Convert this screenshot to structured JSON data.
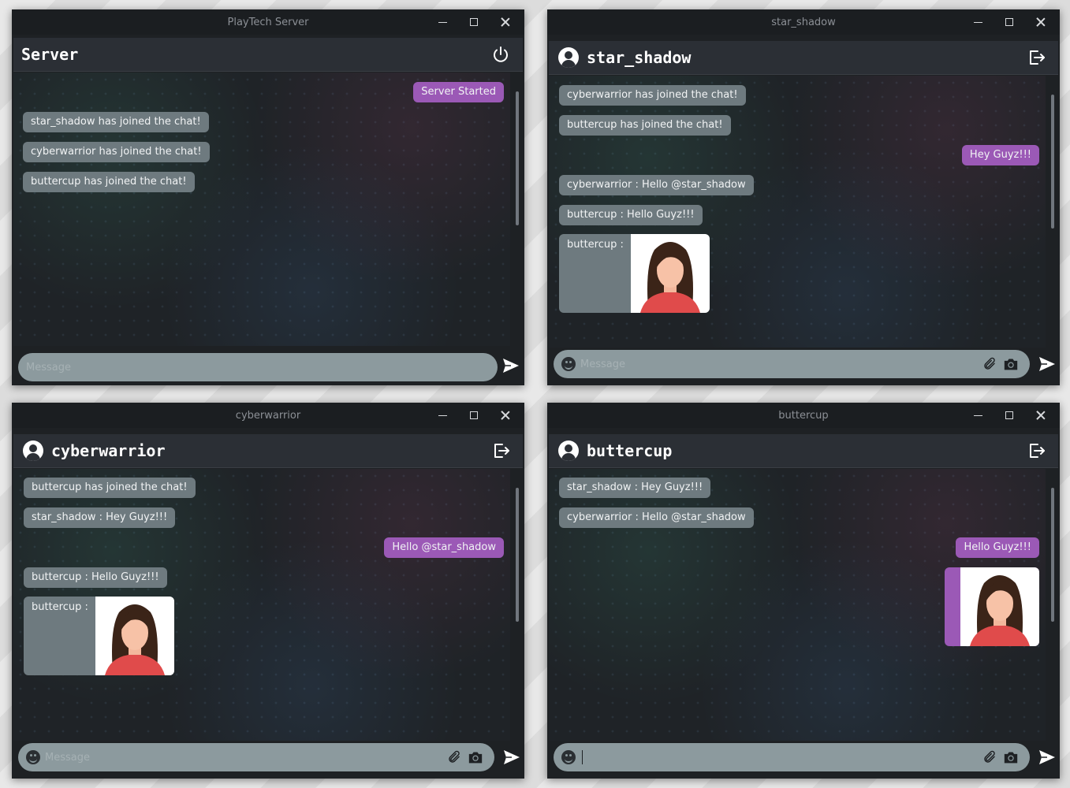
{
  "windows": {
    "server": {
      "title": "PlayTech Server",
      "header": "Server",
      "placeholder": "Message",
      "messages": [
        "Server Started",
        "star_shadow has joined the chat!",
        "cyberwarrior has joined the chat!",
        "buttercup has joined the chat!"
      ]
    },
    "star": {
      "title": "star_shadow",
      "header": "star_shadow",
      "placeholder": "Message",
      "messages": [
        "cyberwarrior has joined the chat!",
        "buttercup has joined the chat!",
        "Hey Guyz!!!",
        "cyberwarrior : Hello @star_shadow",
        "buttercup : Hello Guyz!!!",
        "buttercup :"
      ]
    },
    "cyber": {
      "title": "cyberwarrior",
      "header": "cyberwarrior",
      "placeholder": "Message",
      "messages": [
        "buttercup has joined the chat!",
        "star_shadow : Hey Guyz!!!",
        "Hello @star_shadow",
        "buttercup : Hello Guyz!!!",
        "buttercup :"
      ]
    },
    "butter": {
      "title": "buttercup",
      "header": "buttercup",
      "placeholder": "",
      "messages": [
        "star_shadow : Hey Guyz!!!",
        "cyberwarrior : Hello @star_shadow",
        "Hello Guyz!!!"
      ]
    }
  },
  "icons": {
    "power": "power-icon",
    "logout": "logout-icon",
    "user": "user-circle-icon",
    "emoji": "emoji-icon",
    "attach": "paperclip-icon",
    "camera": "camera-icon",
    "send": "send-icon"
  },
  "colors": {
    "incoming_bubble": "#6e7a7f",
    "outgoing_bubble": "#9b59b6",
    "input_bar": "#8c9a9e",
    "header": "#2b2f35"
  }
}
